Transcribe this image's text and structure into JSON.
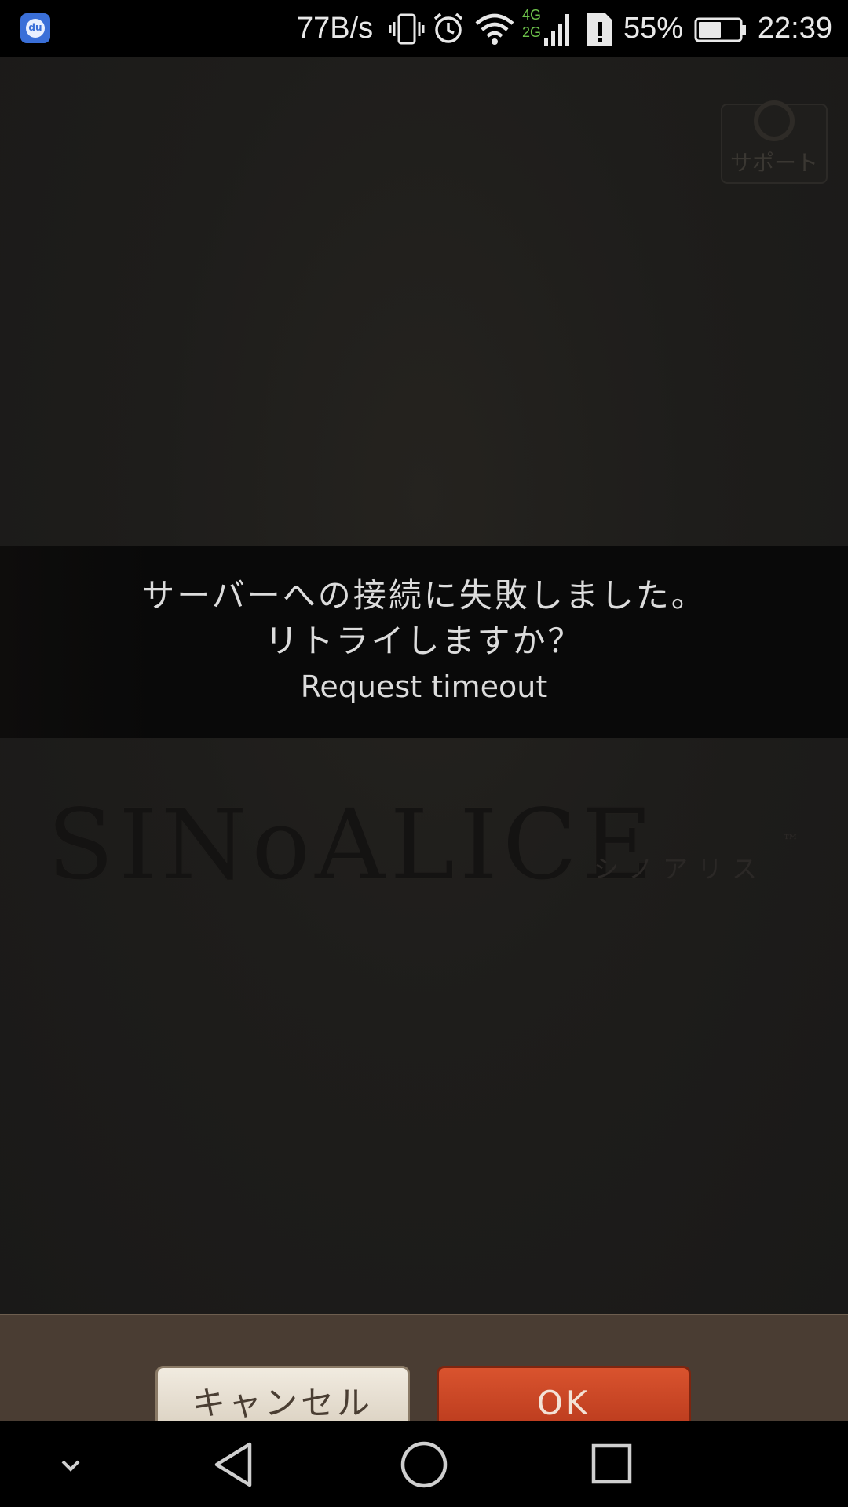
{
  "status_bar": {
    "app_icon": "baidu-icon",
    "app_icon_text": "du",
    "net_speed": "77B/s",
    "icons": [
      "vibrate-icon",
      "alarm-icon",
      "wifi-icon",
      "signal-icon",
      "sim-alert-icon",
      "battery-icon"
    ],
    "network_top": "4G",
    "network_bottom": "2G",
    "battery_percent": "55%",
    "battery_level": 0.55,
    "time": "22:39"
  },
  "game": {
    "support_label": "サポート",
    "logo_text": "SINoALICE",
    "logo_tm": "™",
    "logo_sub": "シノアリス"
  },
  "dialog": {
    "message_line1": "サーバーへの接続に失敗しました。",
    "message_line2": "リトライしますか？",
    "error_detail": "Request timeout"
  },
  "buttons": {
    "cancel_label": "キャンセル",
    "ok_label": "OK"
  },
  "nav_bar": {
    "icons": [
      "hide-icon",
      "back-icon",
      "home-icon",
      "recents-icon"
    ]
  },
  "colors": {
    "dialog_bg": "#090909",
    "ok_button": "#c8452a",
    "cancel_button": "#e8e0d2",
    "tray_bg": "#4a3d33"
  }
}
